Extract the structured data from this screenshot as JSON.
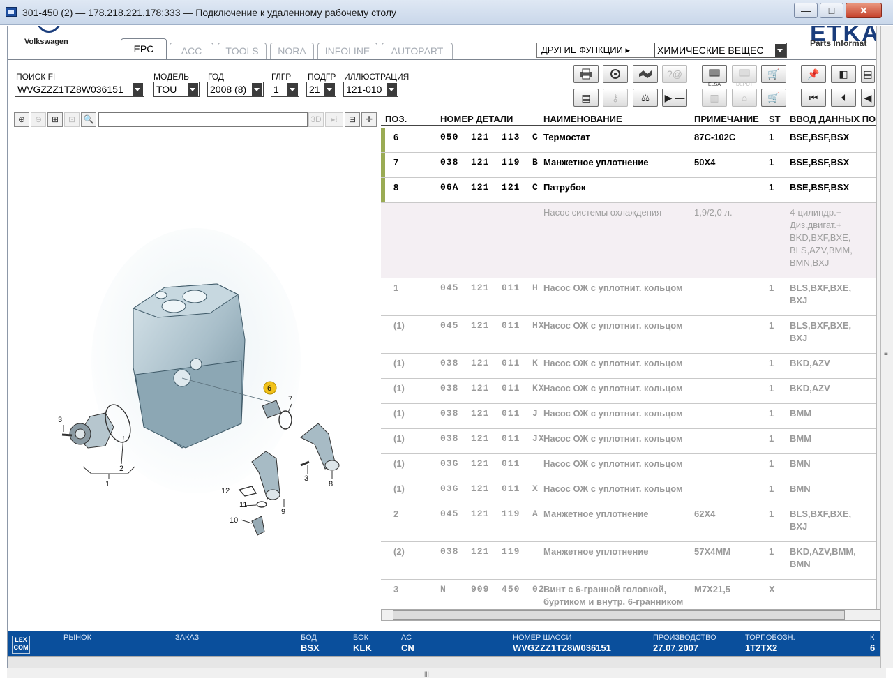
{
  "window": {
    "title": "301-450 (2) — 178.218.221.178:333 — Подключение к удаленному рабочему столу",
    "minimize": "—",
    "restore": "□",
    "close": "✕"
  },
  "brand": {
    "vw_label": "Volkswagen",
    "etka": "ETKA",
    "etka_sub": "Parts Informat"
  },
  "tabs": [
    {
      "label": "EPC",
      "active": true
    },
    {
      "label": "ACC",
      "active": false
    },
    {
      "label": "TOOLS",
      "active": false
    },
    {
      "label": "NORA",
      "active": false
    },
    {
      "label": "INFOLINE",
      "active": false
    },
    {
      "label": "AUTOPART",
      "active": false
    }
  ],
  "other_functions": {
    "label": "ДРУГИЕ ФУНКЦИИ ▸",
    "selected": "ХИМИЧЕСКИЕ ВЕЩЕС"
  },
  "filters": {
    "search_fi": {
      "label": "ПОИСК FI",
      "value": "WVGZZZ1TZ8W036151"
    },
    "model": {
      "label": "МОДЕЛЬ",
      "value": "TOU"
    },
    "year": {
      "label": "ГОД",
      "value": "2008 (8)"
    },
    "mgr": {
      "label": "ГЛГР",
      "value": "1"
    },
    "subgr": {
      "label": "ПОДГР",
      "value": "21"
    },
    "illustration": {
      "label": "ИЛЛЮСТРАЦИЯ",
      "value": "121-010"
    }
  },
  "toolbar": {
    "elsa_label": "ELSA",
    "depot_label": "DEPOT"
  },
  "illustration": {
    "zoom_3d": "3D",
    "callouts": [
      "1",
      "2",
      "3",
      "3",
      "6",
      "7",
      "8",
      "9",
      "10",
      "11",
      "12"
    ]
  },
  "grid": {
    "headers": {
      "pos": "ПОЗ.",
      "part_no": "НОМЕР ДЕТАЛИ",
      "name": "НАИМЕНОВАНИЕ",
      "note": "ПРИМЕЧАНИЕ",
      "st": "ST",
      "input": "ВВОД ДАННЫХ ПО"
    },
    "rows": [
      {
        "pos": "6",
        "part": "050  121  113  C",
        "name": "Термостат",
        "note": "87C-102C",
        "st": "1",
        "input": "BSE,BSF,BSX",
        "style": "active"
      },
      {
        "pos": "7",
        "part": "038  121  119  B",
        "name": "Манжетное уплотнение",
        "note": "50X4",
        "st": "1",
        "input": "BSE,BSF,BSX",
        "style": "active"
      },
      {
        "pos": "8",
        "part": "06A  121  121  C",
        "name": "Патрубок",
        "note": "",
        "st": "1",
        "input": "BSE,BSF,BSX",
        "style": "active"
      },
      {
        "pos": "",
        "part": "",
        "name": "Насос системы охлаждения",
        "note": "1,9/2,0 л.",
        "st": "",
        "input": "4-цилиндр.+\nДиз.двигат.+\nBKD,BXF,BXE,\nBLS,AZV,BMM,\nBMN,BXJ",
        "style": "hdr"
      },
      {
        "pos": "1",
        "part": "045  121  011  H",
        "name": "Насос ОЖ с уплотнит. кольцом",
        "note": "",
        "st": "1",
        "input": "BLS,BXF,BXE,\nBXJ",
        "style": "gray"
      },
      {
        "pos": "(1)",
        "part": "045  121  011  HX",
        "name": "Насос ОЖ с уплотнит. кольцом",
        "note": "",
        "st": "1",
        "input": "BLS,BXF,BXE,\nBXJ",
        "style": "gray"
      },
      {
        "pos": "(1)",
        "part": "038  121  011  K",
        "name": "Насос ОЖ с уплотнит. кольцом",
        "note": "",
        "st": "1",
        "input": "BKD,AZV",
        "style": "gray"
      },
      {
        "pos": "(1)",
        "part": "038  121  011  KX",
        "name": "Насос ОЖ с уплотнит. кольцом",
        "note": "",
        "st": "1",
        "input": "BKD,AZV",
        "style": "gray"
      },
      {
        "pos": "(1)",
        "part": "038  121  011  J",
        "name": "Насос ОЖ с уплотнит. кольцом",
        "note": "",
        "st": "1",
        "input": "BMM",
        "style": "gray"
      },
      {
        "pos": "(1)",
        "part": "038  121  011  JX",
        "name": "Насос ОЖ с уплотнит. кольцом",
        "note": "",
        "st": "1",
        "input": "BMM",
        "style": "gray"
      },
      {
        "pos": "(1)",
        "part": "03G  121  011",
        "name": "Насос ОЖ с уплотнит. кольцом",
        "note": "",
        "st": "1",
        "input": "BMN",
        "style": "gray"
      },
      {
        "pos": "(1)",
        "part": "03G  121  011  X",
        "name": "Насос ОЖ с уплотнит. кольцом",
        "note": "",
        "st": "1",
        "input": "BMN",
        "style": "gray"
      },
      {
        "pos": "2",
        "part": "045  121  119  A",
        "name": "Манжетное уплотнение",
        "note": "62X4",
        "st": "1",
        "input": "BLS,BXF,BXE,\nBXJ",
        "style": "gray"
      },
      {
        "pos": "(2)",
        "part": "038  121  119",
        "name": "Манжетное уплотнение",
        "note": "57X4MM",
        "st": "1",
        "input": "BKD,AZV,BMM,\nBMN",
        "style": "gray"
      },
      {
        "pos": "3",
        "part": "N    909  450  02",
        "name": "Винт с 6-гранной головкой,\nбуртиком и внутр. 6-гранником",
        "note": "M7X21,5",
        "st": "X",
        "input": "",
        "style": "gray"
      }
    ]
  },
  "status": {
    "lexcom": "LEX\nCOM",
    "market_label": "РЫНОК",
    "market_value": "",
    "order_label": "ЗАКАЗ",
    "order_value": "",
    "bod_label": "БОД",
    "bod_value": "BSX",
    "bok_label": "БОК",
    "bok_value": "KLK",
    "ac_label": "АС",
    "ac_value": "CN",
    "chassis_label": "НОМЕР ШАССИ",
    "chassis_value": "WVGZZZ1TZ8W036151",
    "prod_label": "ПРОИЗВОДСТВО",
    "prod_value": "27.07.2007",
    "trade_label": "ТОРГ.ОБОЗН.",
    "trade_value": "1T2TX2",
    "k_label": "К",
    "k_value": "6"
  }
}
